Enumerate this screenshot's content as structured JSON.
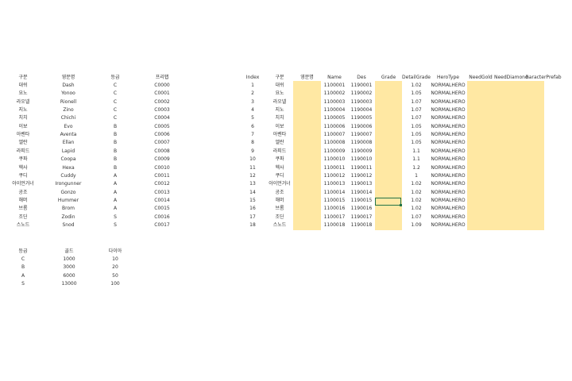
{
  "left_table": {
    "headers": [
      "구분",
      "영문명",
      "등급",
      "프리팹"
    ],
    "rows": [
      [
        "대쉬",
        "Dash",
        "C",
        "C0000"
      ],
      [
        "요노",
        "Yonoo",
        "C",
        "C0001"
      ],
      [
        "라오넬",
        "Rionell",
        "C",
        "C0002"
      ],
      [
        "지노",
        "Zino",
        "C",
        "C0003"
      ],
      [
        "치치",
        "Chichi",
        "C",
        "C0004"
      ],
      [
        "이보",
        "Evo",
        "B",
        "C0005"
      ],
      [
        "아벤타",
        "Aventa",
        "B",
        "C0006"
      ],
      [
        "엘란",
        "Ellan",
        "B",
        "C0007"
      ],
      [
        "라피드",
        "Lapid",
        "B",
        "C0008"
      ],
      [
        "쿠파",
        "Coopa",
        "B",
        "C0009"
      ],
      [
        "헥사",
        "Hexa",
        "B",
        "C0010"
      ],
      [
        "쿠디",
        "Cuddy",
        "A",
        "C0011"
      ],
      [
        "아이언거너",
        "Irongunner",
        "A",
        "C0012"
      ],
      [
        "공조",
        "Gonzo",
        "A",
        "C0013"
      ],
      [
        "해머",
        "Hummer",
        "A",
        "C0014"
      ],
      [
        "브롬",
        "Brom",
        "A",
        "C0015"
      ],
      [
        "조딘",
        "Zodin",
        "S",
        "C0016"
      ],
      [
        "스노드",
        "Snod",
        "S",
        "C0017"
      ]
    ]
  },
  "price_table": {
    "headers": [
      "등급",
      "골드",
      "다이아"
    ],
    "rows": [
      [
        "C",
        "1000",
        "10"
      ],
      [
        "B",
        "3000",
        "20"
      ],
      [
        "A",
        "6000",
        "50"
      ],
      [
        "S",
        "13000",
        "100"
      ]
    ]
  },
  "right_table": {
    "headers": [
      "Index",
      "구분",
      "영문명",
      "Name",
      "Des",
      "Grade",
      "DetailGrade",
      "HeroType",
      "NeedGold",
      "NeedDiamond",
      "haracterPrefab"
    ],
    "rows": [
      [
        "1",
        "대쉬",
        "",
        "1100001",
        "1190001",
        "",
        "1.02",
        "NORMALHERO"
      ],
      [
        "2",
        "요노",
        "",
        "1100002",
        "1190002",
        "",
        "1.05",
        "NORMALHERO"
      ],
      [
        "3",
        "라오넬",
        "",
        "1100003",
        "1190003",
        "",
        "1.07",
        "NORMALHERO"
      ],
      [
        "4",
        "지노",
        "",
        "1100004",
        "1190004",
        "",
        "1.07",
        "NORMALHERO"
      ],
      [
        "5",
        "치치",
        "",
        "1100005",
        "1190005",
        "",
        "1.07",
        "NORMALHERO"
      ],
      [
        "6",
        "이보",
        "",
        "1100006",
        "1190006",
        "",
        "1.05",
        "NORMALHERO"
      ],
      [
        "7",
        "아벤타",
        "",
        "1100007",
        "1190007",
        "",
        "1.05",
        "NORMALHERO"
      ],
      [
        "8",
        "엘란",
        "",
        "1100008",
        "1190008",
        "",
        "1.05",
        "NORMALHERO"
      ],
      [
        "9",
        "라피드",
        "",
        "1100009",
        "1190009",
        "",
        "1.1",
        "NORMALHERO"
      ],
      [
        "10",
        "쿠파",
        "",
        "1100010",
        "1190010",
        "",
        "1.1",
        "NORMALHERO"
      ],
      [
        "11",
        "헥사",
        "",
        "1100011",
        "1190011",
        "",
        "1.2",
        "NORMALHERO"
      ],
      [
        "12",
        "쿠디",
        "",
        "1100012",
        "1190012",
        "",
        "1",
        "NORMALHERO"
      ],
      [
        "13",
        "아이언거너",
        "",
        "1100013",
        "1190013",
        "",
        "1.02",
        "NORMALHERO"
      ],
      [
        "14",
        "공조",
        "",
        "1100014",
        "1190014",
        "",
        "1.02",
        "NORMALHERO"
      ],
      [
        "15",
        "해머",
        "",
        "1100015",
        "1190015",
        "",
        "1.02",
        "NORMALHERO"
      ],
      [
        "16",
        "브롬",
        "",
        "1100016",
        "1190016",
        "",
        "1.02",
        "NORMALHERO"
      ],
      [
        "17",
        "조딘",
        "",
        "1100017",
        "1190017",
        "",
        "1.07",
        "NORMALHERO"
      ],
      [
        "18",
        "스노드",
        "",
        "1100018",
        "1190018",
        "",
        "1.09",
        "NORMALHERO"
      ]
    ]
  },
  "colors": {
    "highlight": "#ffe8a3",
    "selection_border": "#217346",
    "text": "#333333"
  }
}
